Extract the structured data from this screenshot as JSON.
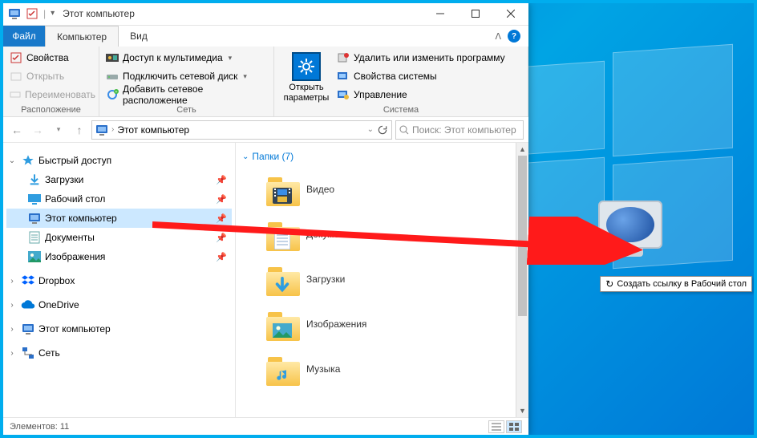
{
  "title": "Этот компьютер",
  "tabs": {
    "file": "Файл",
    "computer": "Компьютер",
    "view": "Вид"
  },
  "ribbon": {
    "location": {
      "label": "Расположение",
      "properties": "Свойства",
      "open": "Открыть",
      "rename": "Переименовать"
    },
    "network": {
      "label": "Сеть",
      "media_access": "Доступ к мультимедиа",
      "map_drive": "Подключить сетевой диск",
      "add_location": "Добавить сетевое расположение"
    },
    "system": {
      "label": "Система",
      "open_settings": "Открыть параметры",
      "uninstall": "Удалить или изменить программу",
      "sys_props": "Свойства системы",
      "manage": "Управление"
    }
  },
  "address": {
    "text": "Этот компьютер"
  },
  "search": {
    "placeholder": "Поиск: Этот компьютер"
  },
  "tree": {
    "quick": "Быстрый доступ",
    "downloads": "Загрузки",
    "desktop": "Рабочий стол",
    "this_pc": "Этот компьютер",
    "documents": "Документы",
    "pictures": "Изображения",
    "dropbox": "Dropbox",
    "onedrive": "OneDrive",
    "this_pc2": "Этот компьютер",
    "network": "Сеть"
  },
  "content": {
    "header": "Папки (7)",
    "video": "Видео",
    "documents": "Документы",
    "downloads": "Загрузки",
    "pictures": "Изображения",
    "music": "Музыка"
  },
  "status": {
    "items": "Элементов: 11"
  },
  "tooltip": "Создать ссылку в Рабочий стол"
}
